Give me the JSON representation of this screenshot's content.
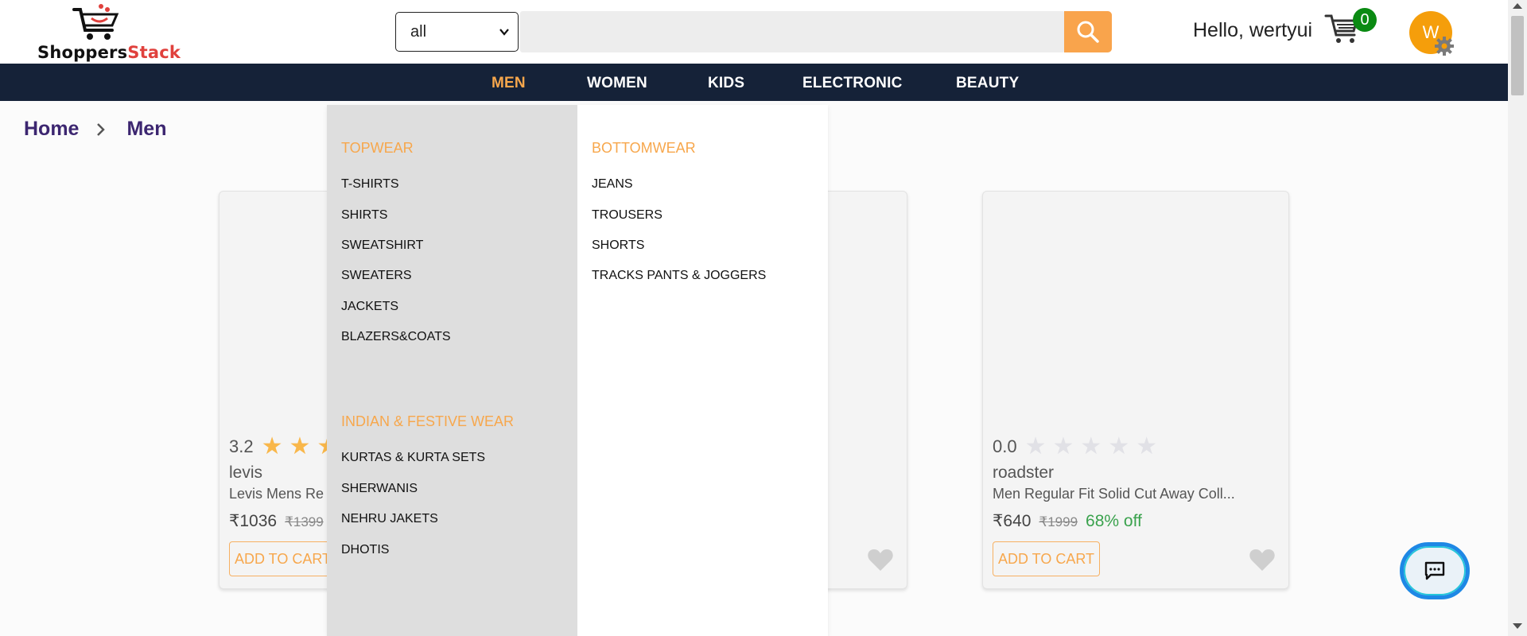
{
  "header": {
    "logo_text_1": "Shoppers",
    "logo_text_2": "Stack",
    "category_select_value": "all",
    "search_placeholder": "",
    "greeting": "Hello, wertyui",
    "cart_count": "0",
    "avatar_initial": "W"
  },
  "nav": {
    "items": [
      {
        "label": "MEN",
        "active": true
      },
      {
        "label": "WOMEN",
        "active": false
      },
      {
        "label": "KIDS",
        "active": false
      },
      {
        "label": "ELECTRONIC",
        "active": false
      },
      {
        "label": "BEAUTY",
        "active": false
      }
    ]
  },
  "breadcrumb": {
    "home": "Home",
    "current": "Men"
  },
  "mega_menu": {
    "topwear": {
      "heading": "TOPWEAR",
      "links": [
        "T-SHIRTS",
        "SHIRTS",
        "SWEATSHIRT",
        "SWEATERS",
        "JACKETS",
        "BLAZERS&COATS"
      ]
    },
    "festive": {
      "heading": "INDIAN & FESTIVE WEAR",
      "links": [
        "KURTAS & KURTA SETS",
        "SHERWANIS",
        "NEHRU JAKETS",
        "DHOTIS"
      ]
    },
    "bottomwear": {
      "heading": "BOTTOMWEAR",
      "links": [
        "JEANS",
        "TROUSERS",
        "SHORTS",
        "TRACKS PANTS & JOGGERS"
      ]
    }
  },
  "products": [
    {
      "rating": "3.2",
      "brand": "levis",
      "name": "Levis Mens Re",
      "price": "₹1036",
      "mrp": "₹1399",
      "off": "",
      "add_label": "ADD TO CART",
      "filled_stars": 3
    },
    {
      "rating": "0.0",
      "brand": "roadster",
      "name": "Men Regular Fit Solid Cut Away Coll...",
      "price": "₹640",
      "mrp": "₹1999",
      "off": "68% off",
      "add_label": "ADD TO CART",
      "filled_stars": 0
    }
  ],
  "colors": {
    "accent": "#f7a74c",
    "nav_bg": "#152238",
    "star_filled": "#f9b74a",
    "star_empty": "#e1e1e6",
    "badge": "#0a8a12"
  },
  "icons": {
    "search": "search-icon",
    "cart": "cart-icon",
    "settings": "gear-icon",
    "chat": "chat-icon",
    "wishlist": "heart-icon"
  }
}
